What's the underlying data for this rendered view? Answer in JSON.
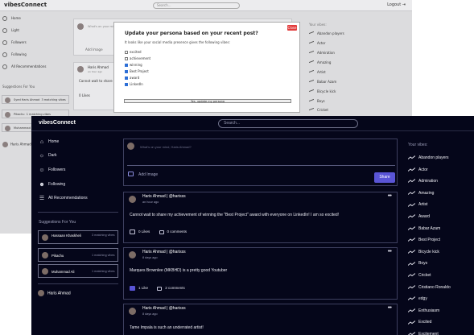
{
  "background": {
    "brand": "vibesConnect",
    "search_placeholder": "Search...",
    "logout": "Logout",
    "nav": [
      "Home",
      "Light",
      "Followers",
      "Following",
      "All Recommendations"
    ],
    "suggestions_title": "Suggestions For You",
    "suggestions": [
      {
        "name": "Syed Haris Ahmad",
        "vibes": "3 matching vibes"
      },
      {
        "name": "Pikachu",
        "vibes": "1 matching vibes"
      },
      {
        "name": "Muhammad Ali",
        "vibes": "1 matching vibes"
      }
    ],
    "current_user": "Haris Ahmad",
    "composer_placeholder": "What's on your mind, Haris Ahmad?",
    "add_image": "Add Image",
    "post_author": "Haris Ahmad",
    "post_time": "an hour ago",
    "post_snippet": "Cannot wait to share",
    "post_likes": "0 Likes",
    "vibes_title": "Your vibes:",
    "vibes": [
      "Abandon players",
      "Actor",
      "Admiration",
      "Amazing",
      "Artist",
      "Babar Azam",
      "Bicycle kick",
      "Boys",
      "Cricket"
    ]
  },
  "modal": {
    "title": "Update your persona based on your recent post?",
    "subtitle": "It looks like your social media presence gives the following vibes:",
    "options": [
      {
        "label": "excited",
        "checked": false
      },
      {
        "label": "achievement",
        "checked": false
      },
      {
        "label": "winning",
        "checked": true
      },
      {
        "label": "Best Project",
        "checked": true
      },
      {
        "label": "award",
        "checked": true
      },
      {
        "label": "LinkedIn",
        "checked": true
      }
    ],
    "update_button": "Yes, update my persona",
    "close": "Close"
  },
  "app": {
    "brand": "vibesConnect",
    "search_placeholder": "Search...",
    "nav": [
      {
        "label": "Home",
        "icon": "home-icon"
      },
      {
        "label": "Dark",
        "icon": "sun-icon"
      },
      {
        "label": "Followers",
        "icon": "followers-icon"
      },
      {
        "label": "Following",
        "icon": "following-icon"
      },
      {
        "label": "All Recommendations",
        "icon": "list-icon"
      }
    ],
    "suggestions_title": "Suggestions For You",
    "suggestions": [
      {
        "name": "Hassaan Khaskheli",
        "vibes": "3 matching vibes"
      },
      {
        "name": "Pikachu",
        "vibes": "1 matching vibes"
      },
      {
        "name": "Muhammad Ali",
        "vibes": "1 matching vibes"
      }
    ],
    "current_user": "Haris Ahmad",
    "composer": {
      "placeholder": "What's on your mind, Haris Ahmad?",
      "add_image": "Add Image",
      "share": "Share"
    },
    "posts": [
      {
        "author": "Haris Ahmad | @harisss",
        "time": "an hour ago",
        "text": "Cannot wait to share my achievement of winning the \"Best Project\" award with everyone on LinkedIn! I am so excited!",
        "likes": "0 Likes",
        "comments": "0 comments",
        "liked": false
      },
      {
        "author": "Haris Ahmad | @harisss",
        "time": "8 days ago",
        "text": "Marques Brownlee (MKBHD) is a pretty good Youtuber",
        "likes": "1 Like",
        "comments": "2 comments",
        "liked": true
      },
      {
        "author": "Haris Ahmad | @harisss",
        "time": "8 days ago",
        "text": "Tame Impala is such an underrated artist!",
        "likes": "",
        "comments": "",
        "liked": false
      }
    ],
    "vibes_title": "Your vibes:",
    "vibes": [
      "Abandon players",
      "Actor",
      "Admiration",
      "Amazing",
      "Artist",
      "Award",
      "Babar Azam",
      "Best Project",
      "Bicycle kick",
      "Boys",
      "Cricket",
      "Cristiano Ronaldo",
      "edgy",
      "Enthusiasm",
      "Excited",
      "Excitement"
    ],
    "colors": {
      "background": "#05061a",
      "accent": "#5a55d6"
    }
  }
}
